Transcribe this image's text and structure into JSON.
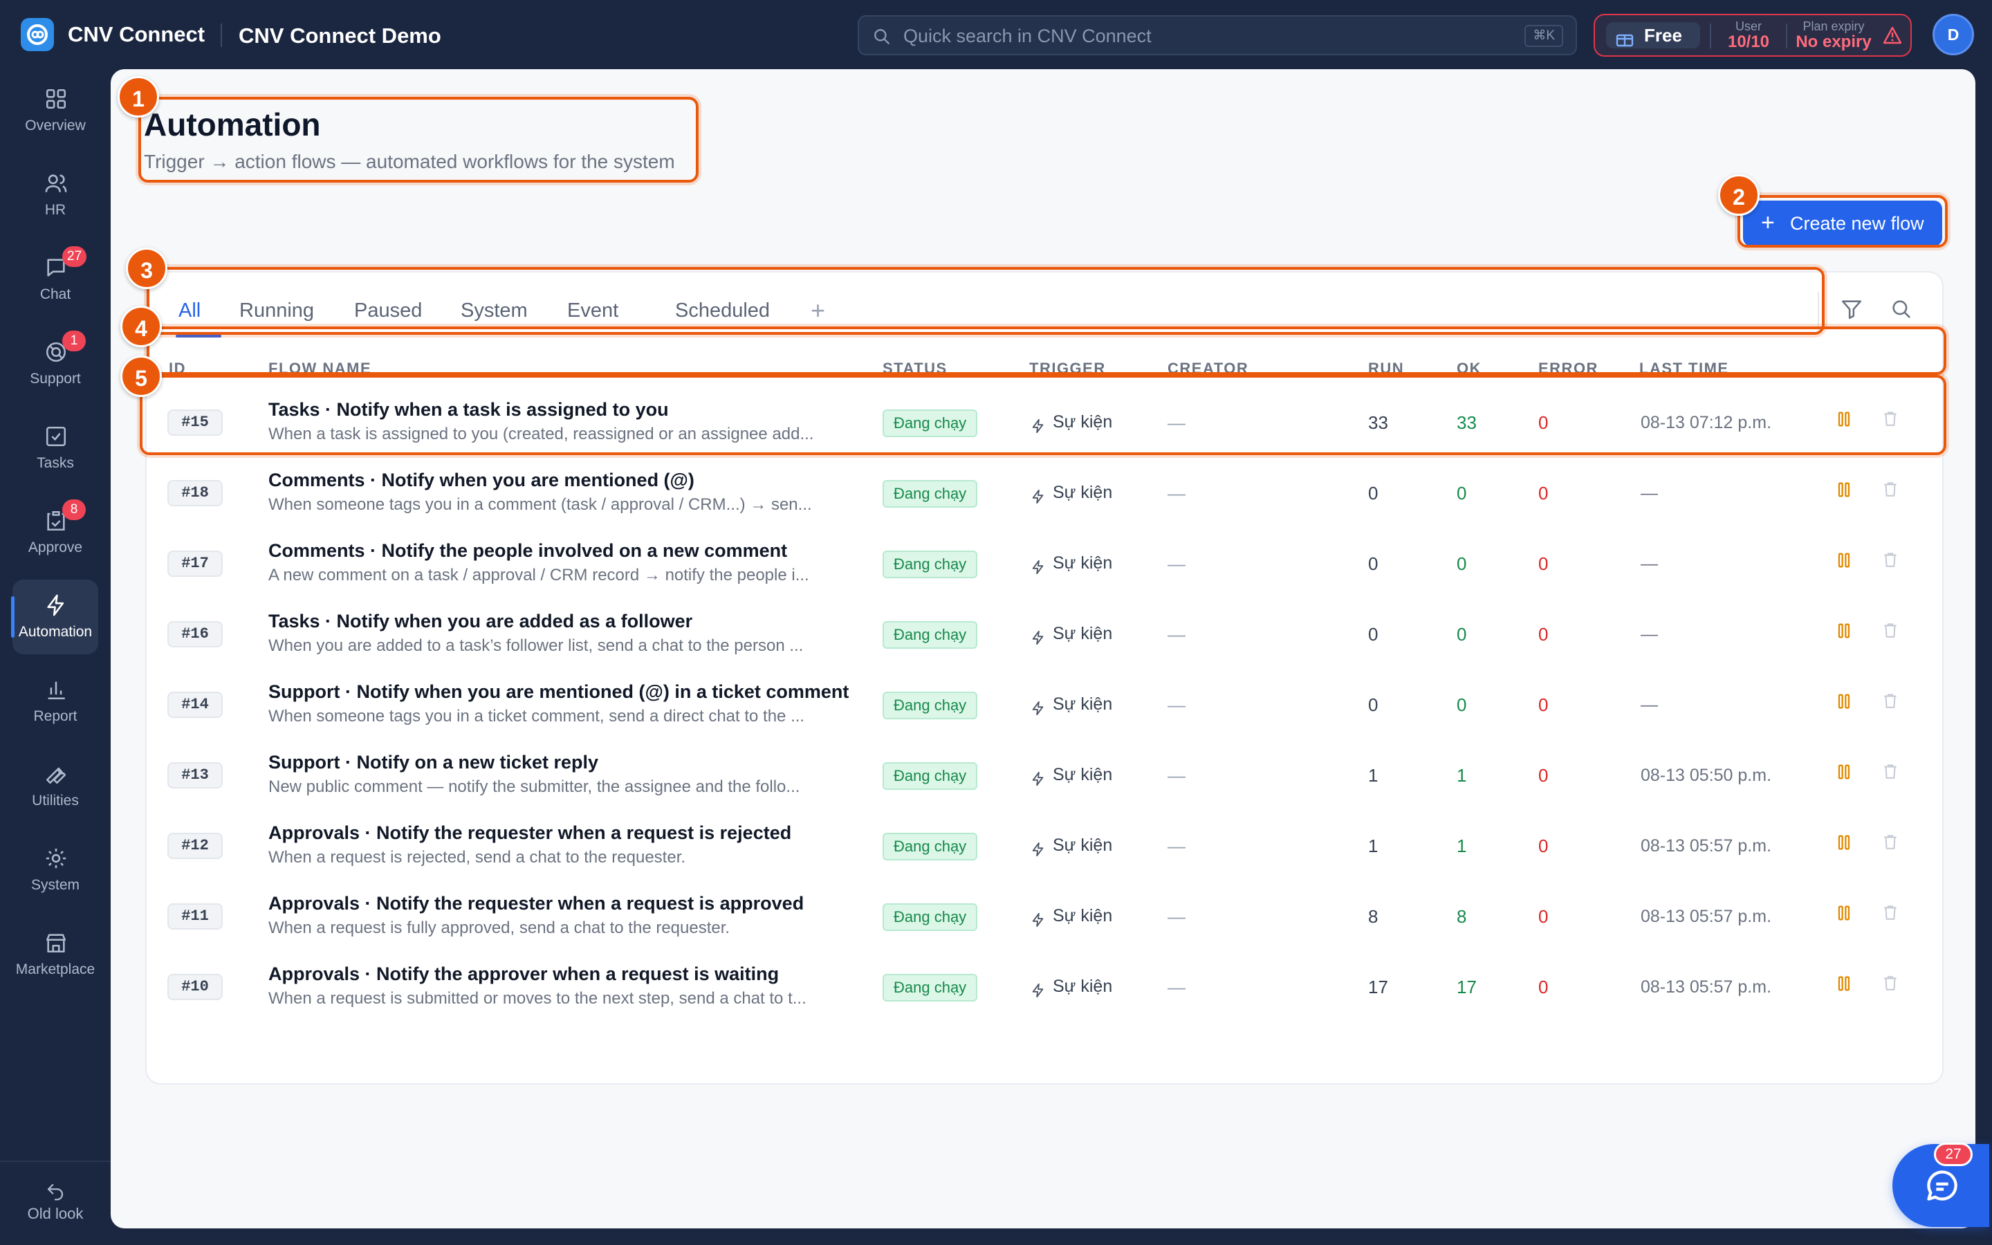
{
  "app": {
    "name": "CNV Connect",
    "workspace": "CNV Connect Demo"
  },
  "search": {
    "placeholder": "Quick search in CNV Connect",
    "shortcut": "⌘K"
  },
  "plan": {
    "tier": "Free",
    "user_label": "User",
    "user_value": "10/10",
    "expiry_label": "Plan expiry",
    "expiry_value": "No expiry"
  },
  "user": {
    "avatar_initial": "D"
  },
  "sidebar": {
    "items": [
      {
        "label": "Overview",
        "icon": "grid-icon"
      },
      {
        "label": "HR",
        "icon": "users-icon"
      },
      {
        "label": "Chat",
        "icon": "chat-icon",
        "badge": "27"
      },
      {
        "label": "Support",
        "icon": "support-icon",
        "badge": "1"
      },
      {
        "label": "Tasks",
        "icon": "check-square-icon"
      },
      {
        "label": "Approve",
        "icon": "approve-icon",
        "badge": "8"
      },
      {
        "label": "Automation",
        "icon": "bolt-icon",
        "active": true
      },
      {
        "label": "Report",
        "icon": "bar-chart-icon"
      },
      {
        "label": "Utilities",
        "icon": "wrench-icon"
      },
      {
        "label": "System",
        "icon": "gear-icon"
      },
      {
        "label": "Marketplace",
        "icon": "store-icon"
      }
    ],
    "old_look": "Old look"
  },
  "page": {
    "title": "Automation",
    "subtitle": "Trigger → action flows — automated workflows for the system",
    "create_button": "Create new flow"
  },
  "tabs": [
    "All",
    "Running",
    "Paused",
    "System",
    "Event",
    "Scheduled"
  ],
  "table": {
    "columns": [
      "ID",
      "FLOW NAME",
      "STATUS",
      "TRIGGER",
      "CREATOR",
      "RUN",
      "OK",
      "ERROR",
      "LAST TIME"
    ],
    "rows": [
      {
        "id": "#15",
        "name": "Tasks · Notify when a task is assigned to you",
        "desc": "When a task is assigned to you (created, reassigned or an assignee add...",
        "status": "Đang chạy",
        "trigger": "Sự kiện",
        "creator": "—",
        "run": "33",
        "ok": "33",
        "error": "0",
        "last": "08-13 07:12 p.m."
      },
      {
        "id": "#18",
        "name": "Comments · Notify when you are mentioned (@)",
        "desc": "When someone tags you in a comment (task / approval / CRM...) → sen...",
        "status": "Đang chạy",
        "trigger": "Sự kiện",
        "creator": "—",
        "run": "0",
        "ok": "0",
        "error": "0",
        "last": "—"
      },
      {
        "id": "#17",
        "name": "Comments · Notify the people involved on a new comment",
        "desc": "A new comment on a task / approval / CRM record → notify the people i...",
        "status": "Đang chạy",
        "trigger": "Sự kiện",
        "creator": "—",
        "run": "0",
        "ok": "0",
        "error": "0",
        "last": "—"
      },
      {
        "id": "#16",
        "name": "Tasks · Notify when you are added as a follower",
        "desc": "When you are added to a task’s follower list, send a chat to the person ...",
        "status": "Đang chạy",
        "trigger": "Sự kiện",
        "creator": "—",
        "run": "0",
        "ok": "0",
        "error": "0",
        "last": "—"
      },
      {
        "id": "#14",
        "name": "Support · Notify when you are mentioned (@) in a ticket comment",
        "desc": "When someone tags you in a ticket comment, send a direct chat to the ...",
        "status": "Đang chạy",
        "trigger": "Sự kiện",
        "creator": "—",
        "run": "0",
        "ok": "0",
        "error": "0",
        "last": "—"
      },
      {
        "id": "#13",
        "name": "Support · Notify on a new ticket reply",
        "desc": "New public comment — notify the submitter, the assignee and the follo...",
        "status": "Đang chạy",
        "trigger": "Sự kiện",
        "creator": "—",
        "run": "1",
        "ok": "1",
        "error": "0",
        "last": "08-13 05:50 p.m."
      },
      {
        "id": "#12",
        "name": "Approvals · Notify the requester when a request is rejected",
        "desc": "When a request is rejected, send a chat to the requester.",
        "status": "Đang chạy",
        "trigger": "Sự kiện",
        "creator": "—",
        "run": "1",
        "ok": "1",
        "error": "0",
        "last": "08-13 05:57 p.m."
      },
      {
        "id": "#11",
        "name": "Approvals · Notify the requester when a request is approved",
        "desc": "When a request is fully approved, send a chat to the requester.",
        "status": "Đang chạy",
        "trigger": "Sự kiện",
        "creator": "—",
        "run": "8",
        "ok": "8",
        "error": "0",
        "last": "08-13 05:57 p.m."
      },
      {
        "id": "#10",
        "name": "Approvals · Notify the approver when a request is waiting",
        "desc": "When a request is submitted or moves to the next step, send a chat to t...",
        "status": "Đang chạy",
        "trigger": "Sự kiện",
        "creator": "—",
        "run": "17",
        "ok": "17",
        "error": "0",
        "last": "08-13 05:57 p.m."
      }
    ]
  },
  "annotations": [
    "1",
    "2",
    "3",
    "4",
    "5"
  ],
  "chat_fab": {
    "badge": "27"
  },
  "colors": {
    "accent": "#2563eb",
    "annotation": "#ea580c",
    "success": "#178a4c",
    "danger": "#dc2626",
    "sidebar_bg": "#1b2741"
  }
}
